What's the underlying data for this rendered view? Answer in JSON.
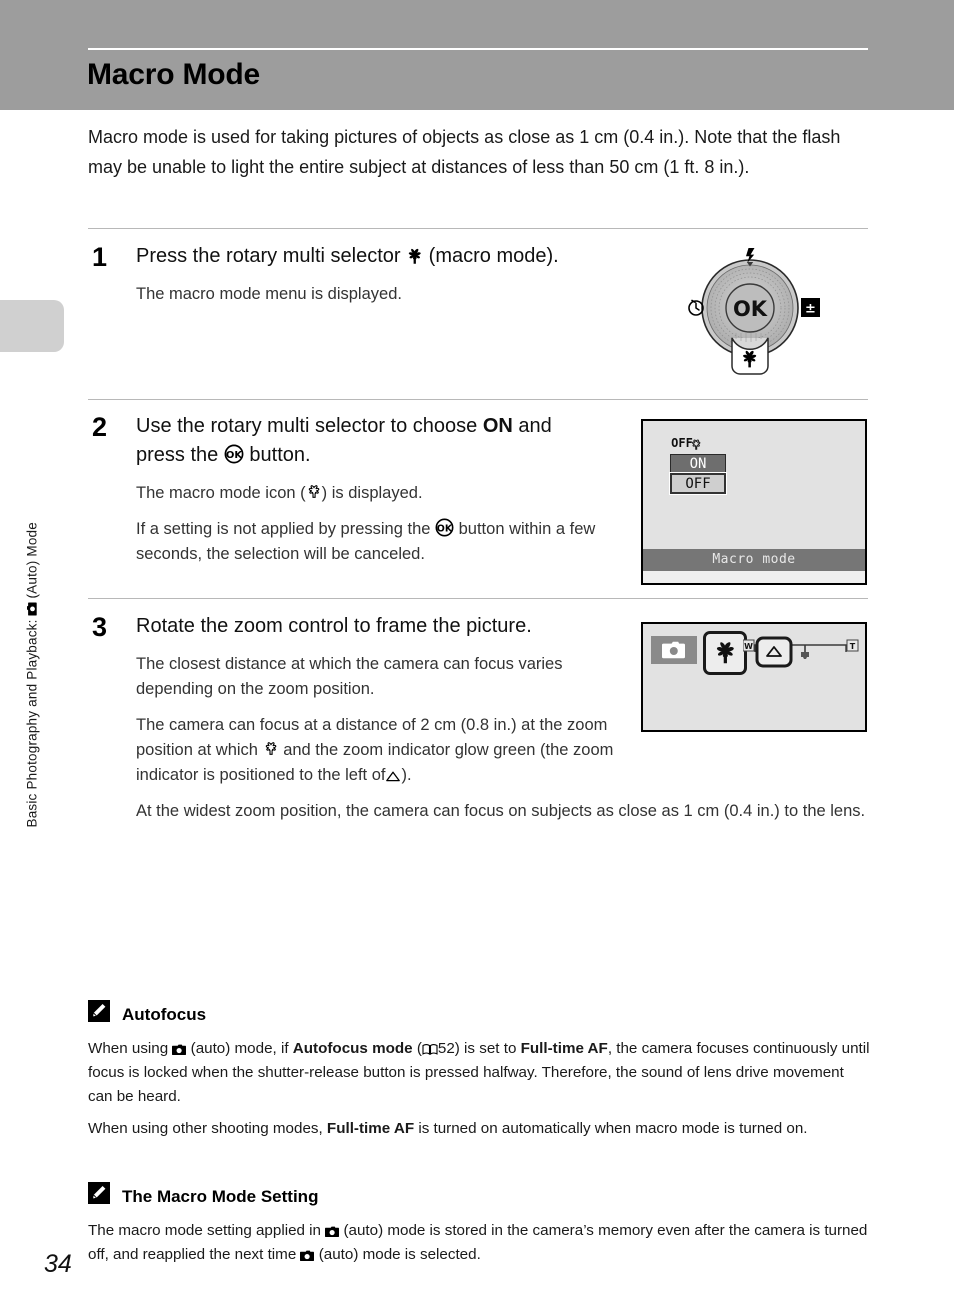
{
  "page": {
    "title": "Macro Mode",
    "number": "34",
    "side_tab_label": "Basic Photography and Playback: ■ (Auto) Mode",
    "side_tab_label_pre": "Basic Photography and Playback:",
    "side_tab_label_post": "(Auto) Mode"
  },
  "intro": {
    "text": "Macro mode is used for taking pictures of objects as close as 1 cm (0.4 in.). Note that the flash may be unable to light the entire subject at distances of less than 50 cm (1 ft. 8 in.)."
  },
  "steps": [
    {
      "number": "1",
      "heading_pre": "Press the rotary multi selector",
      "heading_icon": "macro-flower-icon",
      "heading_post": "(macro mode).",
      "paragraphs": [
        "The macro mode menu is displayed."
      ]
    },
    {
      "number": "2",
      "heading_pre": "Use the rotary multi selector to choose",
      "heading_bold": "ON",
      "heading_mid": "and press the",
      "heading_icon": "ok-button-icon",
      "heading_post": "button.",
      "paragraphs": [
        "The macro mode icon (✿) is displayed.",
        "If a setting is not applied by pressing the OK button within a few seconds, the selection will be canceled."
      ],
      "p1_pre": "The macro mode icon (",
      "p1_post": ") is displayed.",
      "p2_pre": "If a setting is not applied by pressing the",
      "p2_post": "button within a few seconds, the selection will be canceled."
    },
    {
      "number": "3",
      "heading": "Rotate the zoom control to frame the picture.",
      "paragraphs": [
        "The closest distance at which the camera can focus varies depending on the zoom position.",
        "The camera can focus at a distance of 2 cm (0.8 in.) at the zoom position at which and the zoom indicator glow green (the zoom indicator is positioned to the left of ).",
        "At the widest zoom position, the camera can focus on subjects as close as 1 cm (0.4 in.) to the lens."
      ],
      "p1": "The closest distance at which the camera can focus varies depending on the zoom position.",
      "p2_a": "The camera can focus at a distance of 2 cm (0.8 in.) at the zoom position at which",
      "p2_b": "and the zoom indicator glow green (the zoom indicator is positioned to the left of",
      "p2_c": ").",
      "p3": "At the widest zoom position, the camera can focus on subjects as close as 1 cm (0.4 in.) to the lens."
    }
  ],
  "rotary_selector": {
    "center_label": "OK",
    "top_icon": "flash-icon",
    "left_icon": "self-timer-icon",
    "right_icon": "exposure-compensation-icon",
    "bottom_icon": "macro-flower-icon"
  },
  "lcd_macro_menu": {
    "badge_text": "OFF",
    "options": [
      "ON",
      "OFF"
    ],
    "selected": "OFF",
    "bottom_label": "Macro mode"
  },
  "lcd_zoom": {
    "mode_icon": "camera-auto-icon",
    "macro_icon": "macro-flower-icon",
    "wide_label": "W",
    "tele_label": "T",
    "indicator_icon": "triangle-up-icon"
  },
  "notes": [
    {
      "icon": "pencil-note-icon",
      "title": "Autofocus",
      "paragraphs": [
        {
          "segments": [
            {
              "t": "When using ",
              "b": false
            },
            {
              "t": "■",
              "b": false,
              "icon": "camera-auto-icon"
            },
            {
              "t": " (auto) mode, if ",
              "b": false
            },
            {
              "t": "Autofocus mode",
              "b": true
            },
            {
              "t": " (",
              "b": false
            },
            {
              "t": "📖",
              "b": false,
              "icon": "book-icon"
            },
            {
              "t": " 52) is set to ",
              "b": false
            },
            {
              "t": "Full-time AF",
              "b": true
            },
            {
              "t": ", the camera focuses continuously until focus is locked when the shutter-release button is pressed halfway. Therefore, the sound of lens drive movement can be heard.",
              "b": false
            }
          ]
        },
        {
          "segments": [
            {
              "t": "When using other shooting modes, ",
              "b": false
            },
            {
              "t": "Full-time AF",
              "b": true
            },
            {
              "t": " is turned on automatically when macro mode is turned on.",
              "b": false
            }
          ]
        }
      ]
    },
    {
      "icon": "pencil-note-icon",
      "title": "The Macro Mode Setting",
      "paragraphs": [
        {
          "segments": [
            {
              "t": "The macro mode setting applied in ",
              "b": false
            },
            {
              "t": "■",
              "b": false,
              "icon": "camera-auto-icon"
            },
            {
              "t": " (auto) mode is stored in the camera’s memory even after the camera is turned off, and reapplied the next time ",
              "b": false
            },
            {
              "t": "■",
              "b": false,
              "icon": "camera-auto-icon"
            },
            {
              "t": " (auto) mode is selected.",
              "b": false
            }
          ]
        }
      ]
    }
  ],
  "colors": {
    "header_band": "#9d9d9d",
    "side_tab": "#d0d0d0",
    "lcd_bg": "#e2e2e2",
    "lcd_bar": "#767676",
    "divider": "#b8b8b8"
  },
  "note_text_raw": {
    "n1_p1": "When using (auto) mode, if Autofocus mode ( 52) is set to Full-time AF, the camera focuses continuously until focus is locked when the shutter-release button is pressed halfway. Therefore, the sound of lens drive movement can be heard.",
    "n1_p2": "When using other shooting modes, Full-time AF is turned on automatically when macro mode is turned on.",
    "n2_p1": "The macro mode setting applied in (auto) mode is stored in the camera’s memory even after the camera is turned off, and reapplied the next time (auto) mode is selected.",
    "page_ref": "52"
  }
}
